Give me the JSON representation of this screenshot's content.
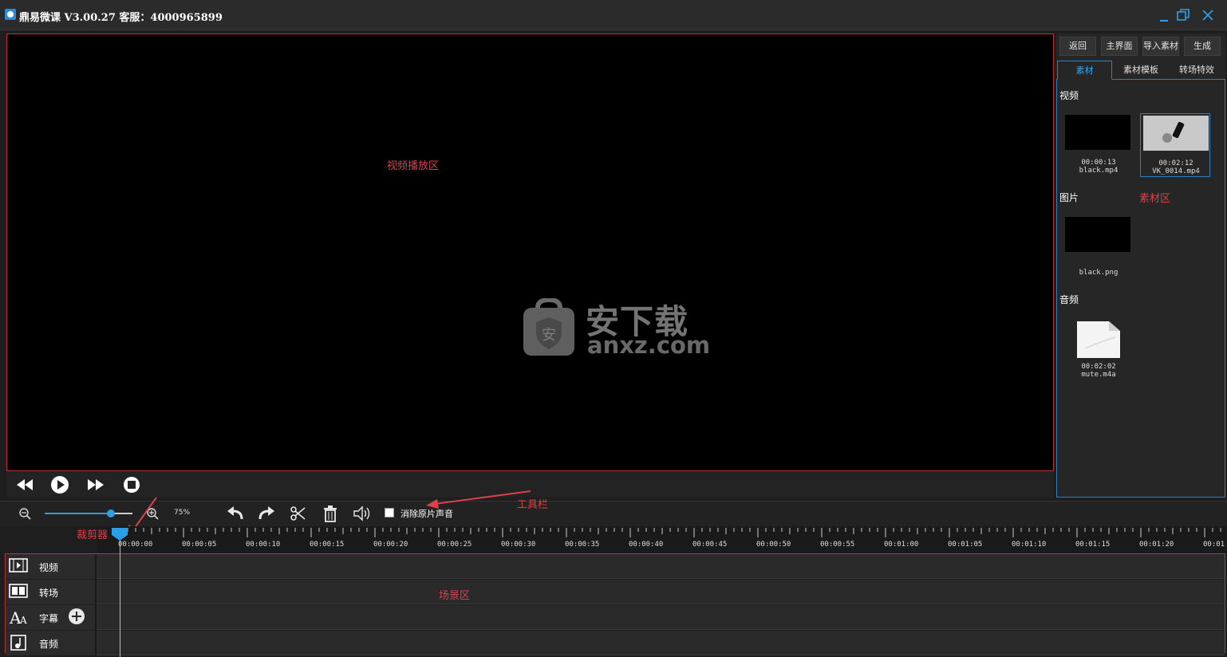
{
  "window": {
    "title": "鼎易微课 V3.00.27 客服：4000965899",
    "minimize_icon": "minimize-icon",
    "restore_icon": "restore-icon",
    "close_icon": "close-icon"
  },
  "preview": {
    "annotation": "视频播放区",
    "watermark_cn": "安下载",
    "watermark_en": "anxz.com",
    "controls": [
      "rewind-icon",
      "play-icon",
      "fast-forward-icon",
      "stop-icon"
    ]
  },
  "panel": {
    "buttons": [
      "返回",
      "主界面",
      "导入素材",
      "生成"
    ],
    "tabs": [
      "素材",
      "素材模板",
      "转场特效"
    ],
    "active_tab": 0,
    "annotation": "素材区",
    "sections": {
      "video": {
        "title": "视频",
        "items": [
          {
            "duration": "00:00:13",
            "name": "black.mp4"
          },
          {
            "duration": "00:02:12",
            "name": "VK_0014.mp4"
          }
        ]
      },
      "image": {
        "title": "图片",
        "items": [
          {
            "name": "black.png"
          }
        ]
      },
      "audio": {
        "title": "音频",
        "items": [
          {
            "duration": "00:02:02",
            "name": "mute.m4a"
          }
        ]
      }
    }
  },
  "toolbar": {
    "zoom_percent": "75%",
    "zoom_level": 0.75,
    "mute_label": "消除原片声音",
    "mute_checked": false,
    "annotation": "工具栏",
    "tools": [
      "zoom-out-icon",
      "zoom-in-icon",
      "undo-icon",
      "redo-icon",
      "scissors-icon",
      "trash-icon",
      "volume-icon"
    ]
  },
  "timeline": {
    "cutter_annotation": "裁剪器",
    "scene_annotation": "场景区",
    "ticks": [
      "00:00:00",
      "00:00:05",
      "00:00:10",
      "00:00:15",
      "00:00:20",
      "00:00:25",
      "00:00:30",
      "00:00:35",
      "00:00:40",
      "00:00:45",
      "00:00:50",
      "00:00:55",
      "00:01:00",
      "00:01:05",
      "00:01:10",
      "00:01:15",
      "00:01:20",
      "00:01"
    ],
    "tracks": [
      {
        "name": "视频",
        "icon": "film-icon"
      },
      {
        "name": "转场",
        "icon": "transition-icon"
      },
      {
        "name": "字幕",
        "icon": "text-icon"
      },
      {
        "name": "音频",
        "icon": "music-icon"
      }
    ],
    "colors": {
      "accent": "#2b9fe6",
      "annotation": "#d9424a",
      "border": "#c0303a"
    }
  }
}
